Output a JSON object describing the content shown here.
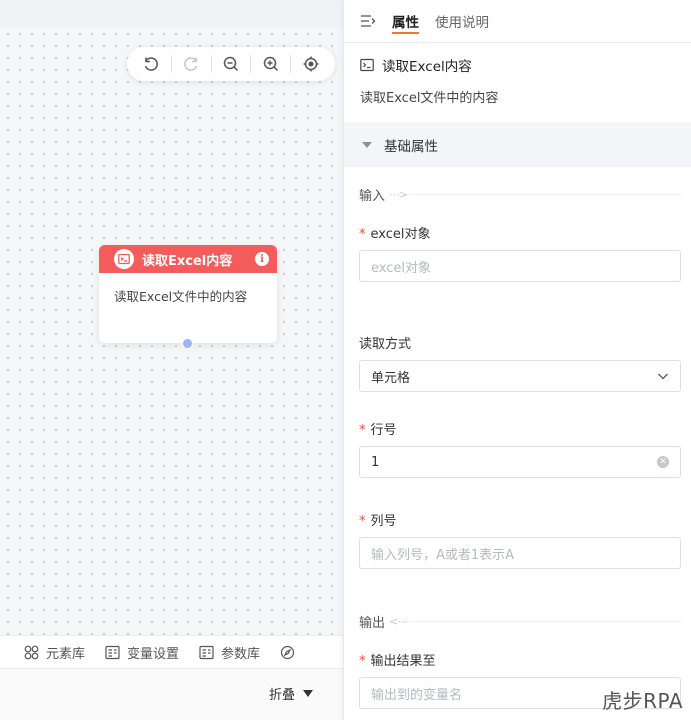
{
  "toolbar": {
    "icons": [
      "undo-icon",
      "redo-icon",
      "zoom-out-icon",
      "zoom-in-icon",
      "locate-icon"
    ]
  },
  "node": {
    "title": "读取Excel内容",
    "description": "读取Excel文件中的内容",
    "header_color": "#f45b5b"
  },
  "bottom_tabs": [
    {
      "label": "元素库",
      "icon": "elements-icon"
    },
    {
      "label": "变量设置",
      "icon": "variable-icon"
    },
    {
      "label": "参数库",
      "icon": "parameter-icon"
    },
    {
      "icon": "compass-icon"
    }
  ],
  "collapse_label": "折叠",
  "panel": {
    "tabs": [
      "属性",
      "使用说明"
    ],
    "active_tab": "属性",
    "accent_color": "#f0763a",
    "component_title": "读取Excel内容",
    "component_desc": "读取Excel文件中的内容",
    "section_title": "基础属性",
    "input_group": "输入",
    "output_group": "输出",
    "fields": {
      "excel_object": {
        "label": "excel对象",
        "required": "*",
        "placeholder": "excel对象",
        "value": ""
      },
      "read_mode": {
        "label": "读取方式",
        "value": "单元格"
      },
      "row": {
        "label": "行号",
        "required": "*",
        "value": "1"
      },
      "column": {
        "label": "列号",
        "required": "*",
        "placeholder": "输入列号，A或者1表示A",
        "value": ""
      },
      "output_to": {
        "label": "输出结果至",
        "required": "*",
        "placeholder": "输出到的变量名",
        "value": ""
      }
    }
  },
  "watermark": "虎步RPA"
}
